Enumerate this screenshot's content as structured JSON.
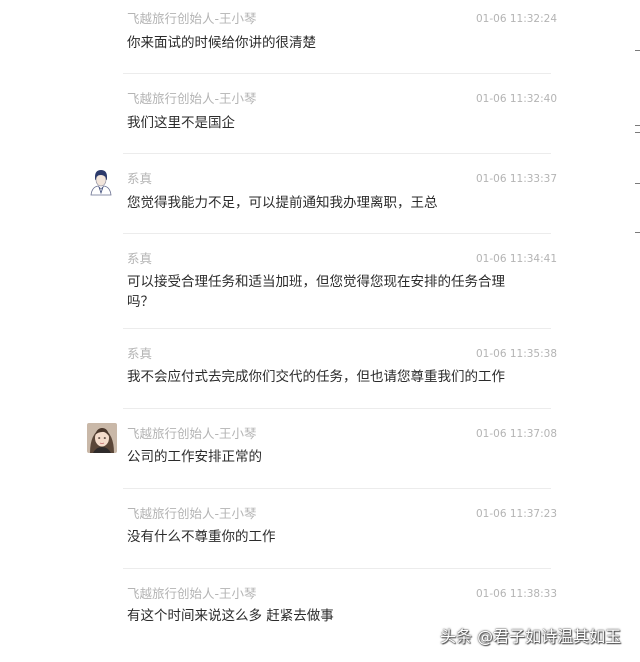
{
  "messages": [
    {
      "sender": "飞越旅行创始人-王小琴",
      "time": "01-06 11:32:24",
      "text": "你来面试的时候给你讲的很清楚",
      "avatar": ""
    },
    {
      "sender": "飞越旅行创始人-王小琴",
      "time": "01-06 11:32:40",
      "text": "我们这里不是国企",
      "avatar": ""
    },
    {
      "sender": "系真",
      "time": "01-06 11:33:37",
      "text": "您觉得我能力不足，可以提前通知我办理离职，王总",
      "avatar": "employee-avatar"
    },
    {
      "sender": "系真",
      "time": "01-06 11:34:41",
      "text": "可以接受合理任务和适当加班，但您觉得您现在安排的任务合理吗？",
      "avatar": ""
    },
    {
      "sender": "系真",
      "time": "01-06 11:35:38",
      "text": "我不会应付式去完成你们交代的任务，但也请您尊重我们的工作",
      "avatar": ""
    },
    {
      "sender": "飞越旅行创始人-王小琴",
      "time": "01-06 11:37:08",
      "text": "公司的工作安排正常的",
      "avatar": "founder-photo-avatar"
    },
    {
      "sender": "飞越旅行创始人-王小琴",
      "time": "01-06 11:37:23",
      "text": "没有什么不尊重你的工作",
      "avatar": ""
    },
    {
      "sender": "飞越旅行创始人-王小琴",
      "time": "01-06 11:38:33",
      "text": "有这个时间来说这么多 赶紧去做事",
      "avatar": ""
    }
  ],
  "watermark": "头条 @君子如诗温其如玉",
  "colors": {
    "sender_text": "#b4b4b4",
    "message_text": "#2b2b2b",
    "divider": "#ececec",
    "background": "#ffffff"
  }
}
